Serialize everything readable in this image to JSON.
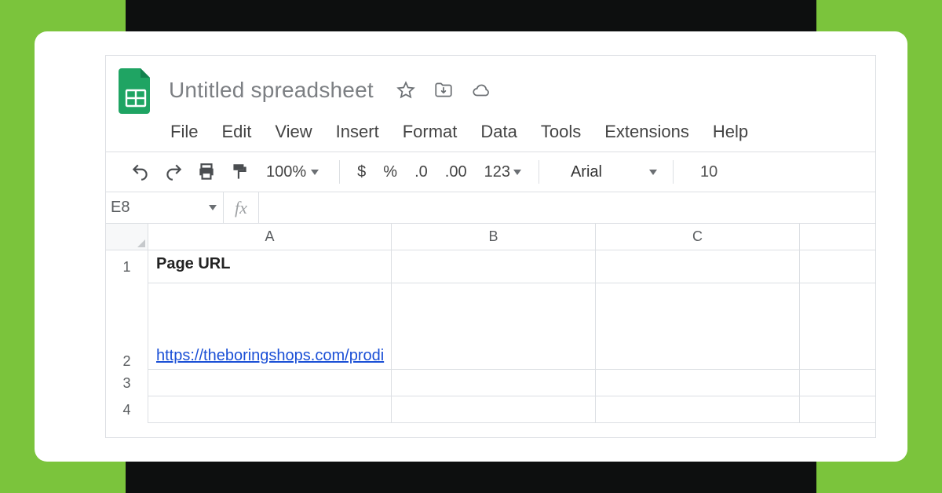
{
  "doc": {
    "title": "Untitled spreadsheet"
  },
  "menu": {
    "file": "File",
    "edit": "Edit",
    "view": "View",
    "insert": "Insert",
    "format": "Format",
    "data": "Data",
    "tools": "Tools",
    "extensions": "Extensions",
    "help": "Help"
  },
  "toolbar": {
    "zoom": "100%",
    "currency": "$",
    "percent": "%",
    "dec_dec": ".0",
    "inc_dec": ".00",
    "more_formats": "123",
    "font": "Arial",
    "font_size": "10"
  },
  "namebox": "E8",
  "fx_label": "fx",
  "columns": {
    "a": "A",
    "b": "B",
    "c": "C"
  },
  "rows": {
    "r1": {
      "num": "1",
      "a": "Page URL"
    },
    "r2": {
      "num": "2",
      "a": "https://theboringshops.com/prodi"
    },
    "r3": {
      "num": "3"
    },
    "r4": {
      "num": "4"
    }
  }
}
